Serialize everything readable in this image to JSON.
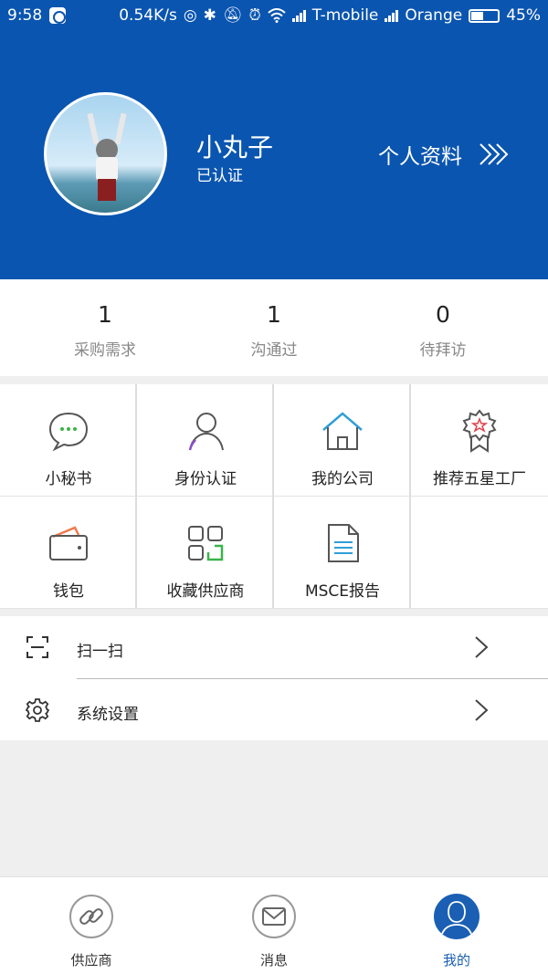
{
  "status_bar": {
    "time": "9:58",
    "speed": "0.54K/s",
    "carrier1": "T-mobile",
    "carrier2": "Orange",
    "battery": "45%",
    "battery_level": 0.45
  },
  "profile": {
    "name": "小丸子",
    "verified": "已认证",
    "link_label": "个人资料",
    "header_color": "#0a55b0"
  },
  "stats": [
    {
      "value": "1",
      "label": "采购需求"
    },
    {
      "value": "1",
      "label": "沟通过"
    },
    {
      "value": "0",
      "label": "待拜访"
    }
  ],
  "grid": [
    {
      "label": "小秘书",
      "icon": "chat-bubble-icon"
    },
    {
      "label": "身份认证",
      "icon": "person-icon"
    },
    {
      "label": "我的公司",
      "icon": "house-icon"
    },
    {
      "label": "推荐五星工厂",
      "icon": "award-ribbon-icon"
    },
    {
      "label": "钱包",
      "icon": "wallet-icon"
    },
    {
      "label": "收藏供应商",
      "icon": "apps-grid-icon"
    },
    {
      "label": "MSCE报告",
      "icon": "document-report-icon"
    }
  ],
  "menu": [
    {
      "label": "扫一扫",
      "icon": "scan-icon"
    },
    {
      "label": "系统设置",
      "icon": "gear-icon"
    }
  ],
  "tabs": [
    {
      "label": "供应商",
      "icon": "link-icon"
    },
    {
      "label": "消息",
      "icon": "envelope-icon"
    },
    {
      "label": "我的",
      "icon": "user-icon",
      "active": true
    }
  ],
  "colors": {
    "accent": "#0a55b0",
    "active_tab_text": "#1a5fb4"
  }
}
